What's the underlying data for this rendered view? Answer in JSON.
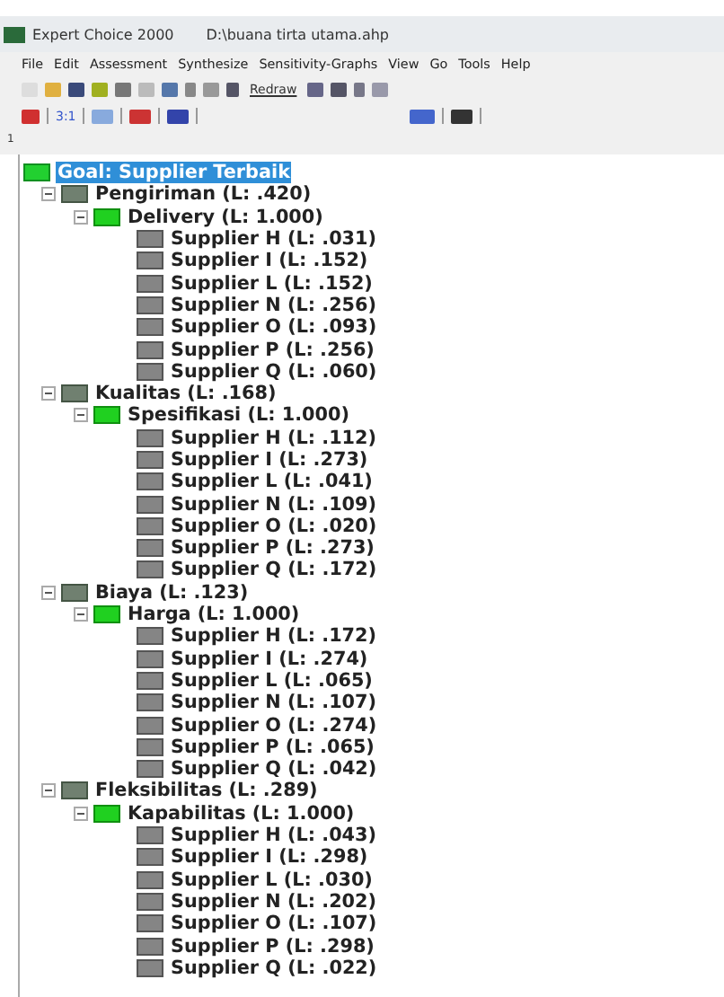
{
  "window": {
    "title": "Expert Choice 2000",
    "file": "D:\\buana tirta utama.ahp"
  },
  "menu": [
    "File",
    "Edit",
    "Assessment",
    "Synthesize",
    "Sensitivity-Graphs",
    "View",
    "Go",
    "Tools",
    "Help"
  ],
  "toolbar": {
    "redraw": "Redraw"
  },
  "toolbar_2": {
    "ratio": "3:1"
  },
  "level_line": "1",
  "tree": {
    "label": "Goal: Supplier Terbaik",
    "selected": true,
    "children": [
      {
        "label": "Pengiriman (L: .420)",
        "expanded": true,
        "children": [
          {
            "label": "Delivery (L: 1.000)",
            "expanded": true,
            "children": [
              {
                "label": "Supplier H (L: .031)"
              },
              {
                "label": "Supplier I (L: .152)"
              },
              {
                "label": "Supplier L (L: .152)"
              },
              {
                "label": "Supplier N (L: .256)"
              },
              {
                "label": "Supplier O (L: .093)"
              },
              {
                "label": "Supplier P (L: .256)"
              },
              {
                "label": "Supplier Q (L: .060)"
              }
            ]
          }
        ]
      },
      {
        "label": "Kualitas (L: .168)",
        "expanded": true,
        "children": [
          {
            "label": "Spesifikasi (L: 1.000)",
            "expanded": true,
            "children": [
              {
                "label": "Supplier H (L: .112)"
              },
              {
                "label": "Supplier I (L: .273)"
              },
              {
                "label": "Supplier L (L: .041)"
              },
              {
                "label": "Supplier N (L: .109)"
              },
              {
                "label": "Supplier O (L: .020)"
              },
              {
                "label": "Supplier P (L: .273)"
              },
              {
                "label": "Supplier Q (L: .172)"
              }
            ]
          }
        ]
      },
      {
        "label": "Biaya (L: .123)",
        "expanded": true,
        "children": [
          {
            "label": "Harga (L: 1.000)",
            "expanded": true,
            "children": [
              {
                "label": "Supplier H (L: .172)"
              },
              {
                "label": "Supplier I (L: .274)"
              },
              {
                "label": "Supplier L (L: .065)"
              },
              {
                "label": "Supplier N (L: .107)"
              },
              {
                "label": "Supplier O (L: .274)"
              },
              {
                "label": "Supplier P (L: .065)"
              },
              {
                "label": "Supplier Q (L: .042)"
              }
            ]
          }
        ]
      },
      {
        "label": "Fleksibilitas (L: .289)",
        "expanded": true,
        "children": [
          {
            "label": "Kapabilitas (L: 1.000)",
            "expanded": true,
            "children": [
              {
                "label": "Supplier H (L: .043)"
              },
              {
                "label": "Supplier I (L: .298)"
              },
              {
                "label": "Supplier L (L: .030)"
              },
              {
                "label": "Supplier N (L: .202)"
              },
              {
                "label": "Supplier O (L: .107)"
              },
              {
                "label": "Supplier P (L: .298)"
              },
              {
                "label": "Supplier Q (L: .022)"
              }
            ]
          }
        ]
      }
    ]
  }
}
